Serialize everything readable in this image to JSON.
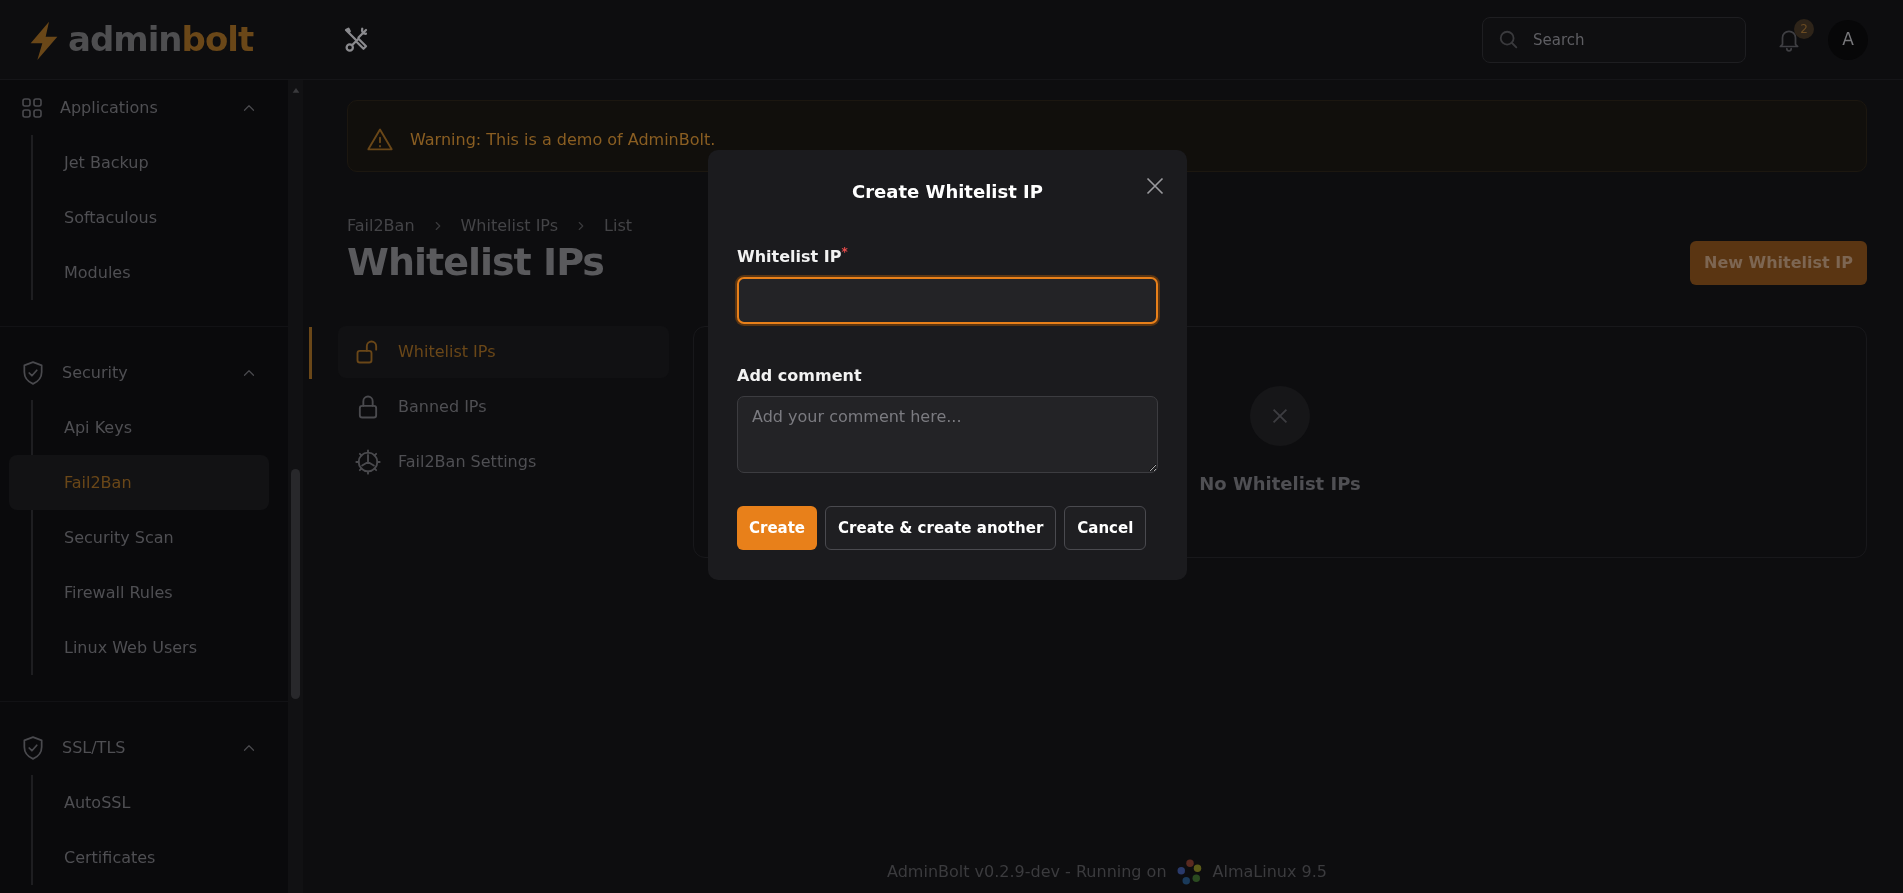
{
  "header": {
    "logo": {
      "part_1": "admin",
      "part_2": "bolt"
    },
    "search": {
      "placeholder": "Search"
    },
    "notifications": {
      "count": "2"
    },
    "avatar": "A"
  },
  "sidebar": {
    "groups": [
      {
        "label": "Applications",
        "kind": "grid",
        "expanded": true,
        "items": [
          {
            "label": "Jet Backup",
            "selected": false
          },
          {
            "label": "Softaculous",
            "selected": false
          },
          {
            "label": "Modules",
            "selected": false
          }
        ]
      },
      {
        "label": "Security",
        "kind": "shield",
        "expanded": true,
        "items": [
          {
            "label": "Api Keys",
            "selected": false
          },
          {
            "label": "Fail2Ban",
            "selected": true
          },
          {
            "label": "Security Scan",
            "selected": false
          },
          {
            "label": "Firewall Rules",
            "selected": false
          },
          {
            "label": "Linux Web Users",
            "selected": false
          }
        ]
      },
      {
        "label": "SSL/TLS",
        "kind": "shield",
        "expanded": true,
        "items": [
          {
            "label": "AutoSSL",
            "selected": false
          },
          {
            "label": "Certificates",
            "selected": false
          }
        ]
      }
    ]
  },
  "banner": {
    "text": "Warning: This is a demo of AdminBolt."
  },
  "breadcrumb": [
    "Fail2Ban",
    "Whitelist IPs",
    "List"
  ],
  "title": "Whitelist IPs",
  "new_button": "New Whitelist IP",
  "subnav": [
    {
      "label": "Whitelist IPs",
      "kind": "unlock",
      "selected": true
    },
    {
      "label": "Banned IPs",
      "kind": "lock",
      "selected": false
    },
    {
      "label": "Fail2Ban Settings",
      "kind": "gear",
      "selected": false
    }
  ],
  "empty_state": {
    "text": "No Whitelist IPs"
  },
  "modal": {
    "title": "Create Whitelist IP",
    "fields": [
      {
        "label": "Whitelist IP",
        "required_mark": "*",
        "kind": "input",
        "focused": true
      },
      {
        "label": "Add comment",
        "kind": "textarea",
        "placeholder": "Add your comment here...",
        "focused": false
      }
    ],
    "buttons": [
      {
        "label": "Create",
        "kind": "primary"
      },
      {
        "label": "Create & create another",
        "kind": "secondary"
      },
      {
        "label": "Cancel",
        "kind": "secondary"
      }
    ]
  },
  "footer": {
    "text": "AdminBolt v0.2.9-dev - Running on",
    "os": "AlmaLinux 9.5"
  }
}
